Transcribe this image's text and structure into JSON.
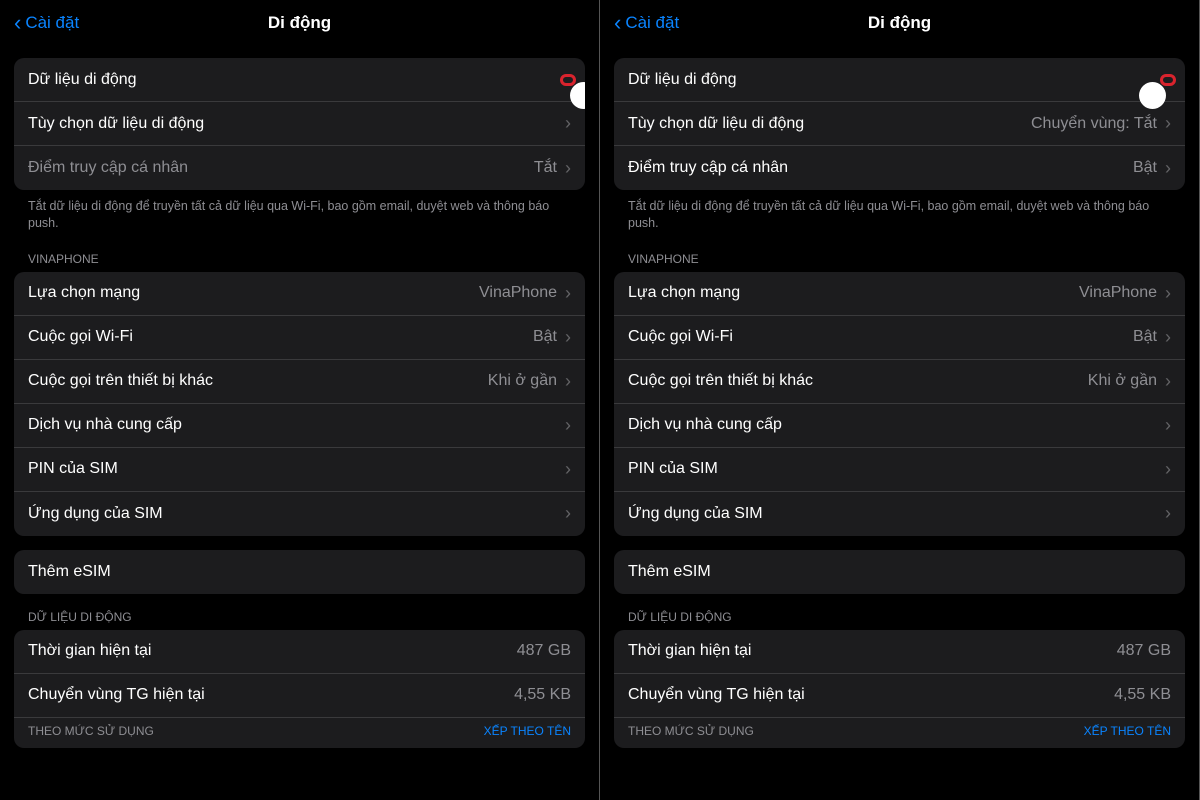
{
  "nav": {
    "back": "Cài đặt",
    "title": "Di động"
  },
  "left": {
    "mobile_data": "Dữ liệu di động",
    "data_options": "Tùy chọn dữ liệu di động",
    "hotspot": "Điểm truy cập cá nhân",
    "hotspot_val": "Tắt"
  },
  "right_panel": {
    "mobile_data": "Dữ liệu di động",
    "data_options": "Tùy chọn dữ liệu di động",
    "data_options_val": "Chuyển vùng: Tắt",
    "hotspot": "Điểm truy cập cá nhân",
    "hotspot_val": "Bật"
  },
  "note": "Tắt dữ liệu di động để truyền tất cả dữ liệu qua Wi-Fi, bao gồm email, duyệt web và thông báo push.",
  "carrier_header": "VINAPHONE",
  "carrier": {
    "network": "Lựa chọn mạng",
    "network_val": "VinaPhone",
    "wifi_call": "Cuộc gọi Wi-Fi",
    "wifi_call_val": "Bật",
    "other_dev": "Cuộc gọi trên thiết bị khác",
    "other_dev_val": "Khi ở gần",
    "carrier_svc": "Dịch vụ nhà cung cấp",
    "sim_pin": "PIN của SIM",
    "sim_apps": "Ứng dụng của SIM"
  },
  "add_esim": "Thêm eSIM",
  "usage_header": "DỮ LIỆU DI ĐỘNG",
  "usage": {
    "current": "Thời gian hiện tại",
    "current_val": "487 GB",
    "roaming": "Chuyển vùng TG hiện tại",
    "roaming_val": "4,55 KB"
  },
  "by_usage": "THEO MỨC SỬ DỤNG",
  "sort_name": "XẾP THEO TÊN"
}
